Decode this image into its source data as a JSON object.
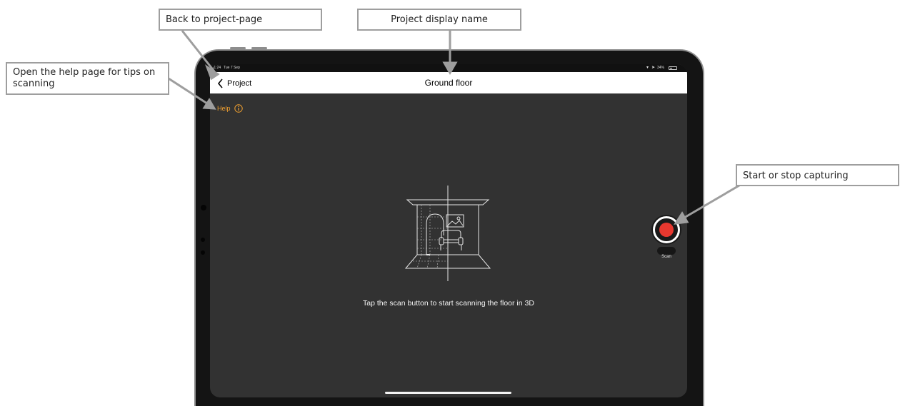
{
  "annotations": {
    "back": "Back to project-page",
    "title": "Project display name",
    "help": "Open the help page for tips on scanning",
    "scan": "Start or stop capturing"
  },
  "status_bar": {
    "time": "11:24",
    "date": "Tue 7 Sep",
    "battery": "34%"
  },
  "nav": {
    "back_label": "Project",
    "title": "Ground floor"
  },
  "help_label": "Help",
  "instruction": "Tap the scan button to start scanning the floor in 3D",
  "scan_label": "Scan",
  "colors": {
    "accent": "#f0a030",
    "record": "#e8382f",
    "screen_bg": "#323232",
    "callout_border": "#9e9e9e"
  },
  "icons": {
    "back": "chevron-left-icon",
    "help": "info-circle-icon",
    "illustration": "room-scan-illustration",
    "record": "record-button-icon"
  }
}
